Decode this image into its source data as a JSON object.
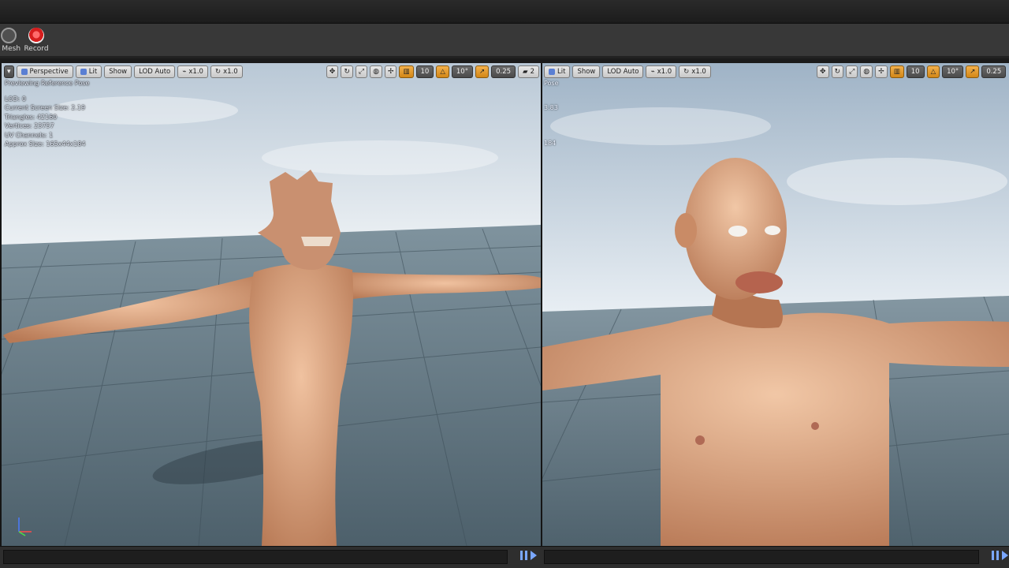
{
  "toolbar": {
    "mesh_label": "t Mesh",
    "record_label": "Record"
  },
  "left_viewport": {
    "menu_arrow": "▾",
    "perspective": "Perspective",
    "lit": "Lit",
    "show": "Show",
    "lod": "LOD Auto",
    "speed1": "x1.0",
    "speed2": "x1.0",
    "grid_snap": "10",
    "rot_snap": "10°",
    "scale_snap": "0.25",
    "cam_speed": "2",
    "overlay": {
      "preview": "Previewing Reference Pose",
      "lod": "LOD: 0",
      "screen_size": "Current Screen Size: 2.19",
      "triangles": "Triangles: 42160",
      "vertices": "Vertices: 23757",
      "uv": "UV Channels: 1",
      "approx": "Approx Size: 165x44x184"
    }
  },
  "right_viewport": {
    "lit": "Lit",
    "show": "Show",
    "lod": "LOD Auto",
    "speed1": "x1.0",
    "speed2": "x1.0",
    "grid_snap": "10",
    "rot_snap": "10°",
    "scale_snap": "0.25",
    "overlay": {
      "pose": "Pose",
      "screen_size": "3.83",
      "approx": "184"
    }
  },
  "colors": {
    "sky_top": "#aebfd0",
    "sky_bottom": "#eef2f6",
    "floor": "#5e717d",
    "skin": "#d9a07a",
    "accent": "#7aa7ff"
  }
}
